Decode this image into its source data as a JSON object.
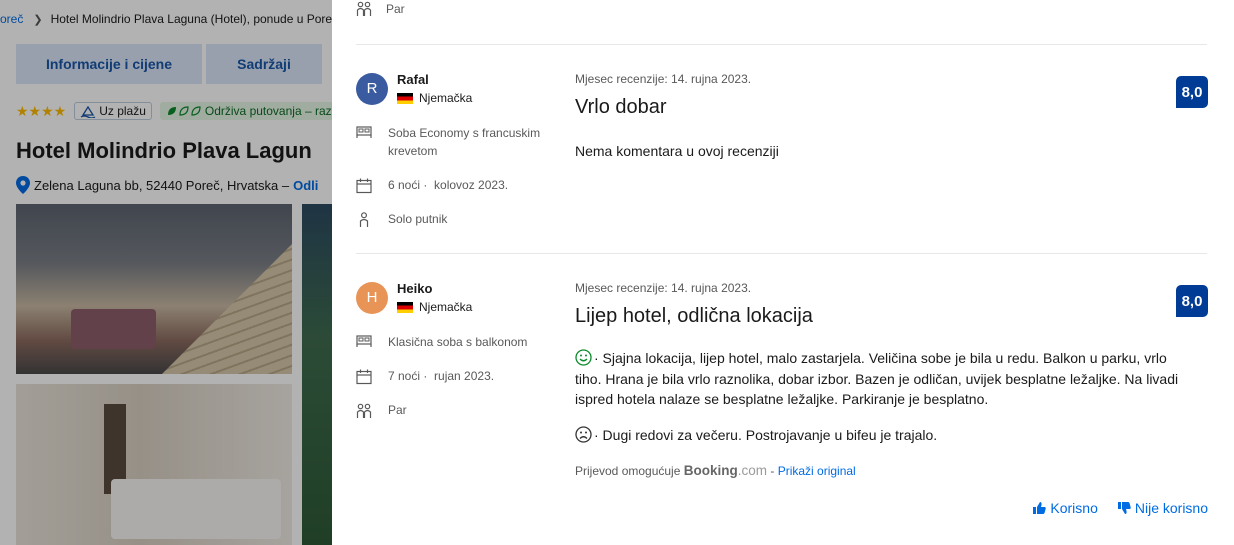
{
  "background_page": {
    "breadcrumb": {
      "first": "oreč",
      "current": "Hotel Molindrio Plava Laguna (Hotel), ponude u Pore"
    },
    "tabs": [
      "Informacije i cijene",
      "Sadržaji"
    ],
    "stars": "★★★★",
    "beach_badge": "Uz plažu",
    "sustainability_badge": "Održiva putovanja – raz",
    "hotel_name": "Hotel Molindrio Plava Lagun",
    "address": "Zelena Laguna bb, 52440 Poreč, Hrvatska –",
    "address_link": "Odli"
  },
  "previous_review": {
    "traveller_type": "Par"
  },
  "reviews": [
    {
      "initial": "R",
      "avatar_color": "#3b5ba0",
      "name": "Rafal",
      "country": "Njemačka",
      "room": "Soba Economy s francuskim krevetom",
      "nights": "6 noći ·",
      "stay_month": "kolovoz 2023.",
      "traveller_type": "Solo putnik",
      "date": "Mjesec recenzije: 14. rujna 2023.",
      "title": "Vrlo dobar",
      "text": "Nema komentara u ovoj recenziji",
      "score": "8,0"
    },
    {
      "initial": "H",
      "avatar_color": "#e89456",
      "name": "Heiko",
      "country": "Njemačka",
      "room": "Klasična soba s balkonom",
      "nights": "7 noći ·",
      "stay_month": "rujan 2023.",
      "traveller_type": "Par",
      "date": "Mjesec recenzije: 14. rujna 2023.",
      "title": "Lijep hotel, odlična lokacija",
      "positive": "· Sjajna lokacija, lijep hotel, malo zastarjela. Veličina sobe je bila u redu. Balkon u parku, vrlo tiho. Hrana je bila vrlo raznolika, dobar izbor. Bazen je odličan, uvijek besplatne ležaljke. Na livadi ispred hotela nalaze se besplatne ležaljke. Parkiranje je besplatno.",
      "negative": "· Dugi redovi za večeru. Postrojavanje u bifeu je trajalo.",
      "translation_prefix": "Prijevod omogućuje",
      "translation_brand": "Booking",
      "translation_brand_suffix": ".com",
      "translation_separator": " - ",
      "show_original": "Prikaži original",
      "score": "8,0"
    }
  ],
  "actions": {
    "helpful": "Korisno",
    "not_helpful": "Nije korisno"
  },
  "colors": {
    "score_bg": "#003b95",
    "link": "#006ce4",
    "positive_face": "#0b8a2b",
    "negative_face": "#333333"
  }
}
